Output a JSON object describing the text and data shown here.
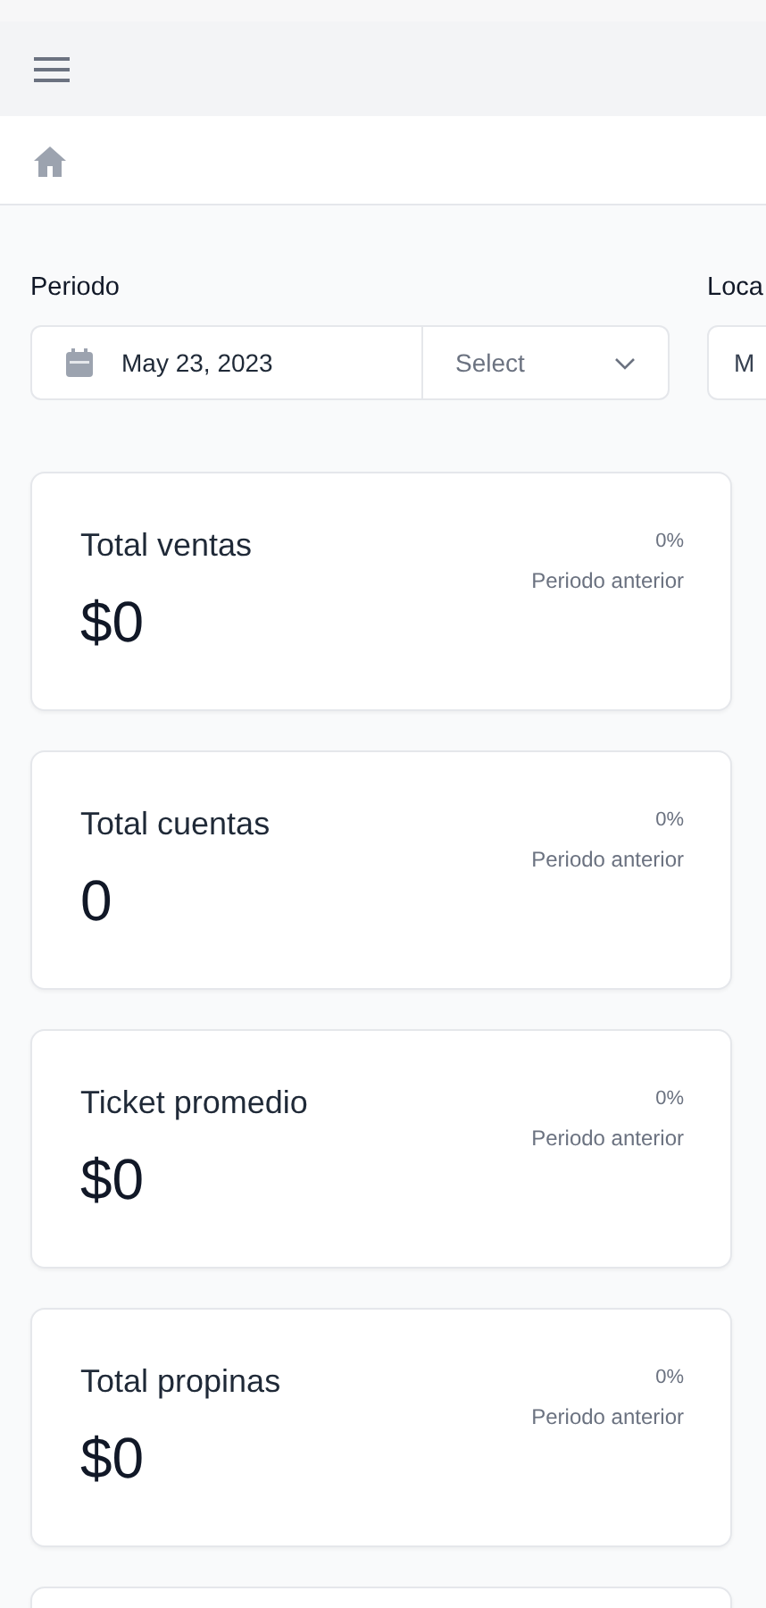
{
  "filters": [
    {
      "label": "Periodo",
      "date": "May 23, 2023",
      "select": "Select"
    },
    {
      "label": "Loca",
      "value": "M"
    }
  ],
  "cards": [
    {
      "title": "Total ventas",
      "value": "$0",
      "change": "0%",
      "caption": "Periodo anterior"
    },
    {
      "title": "Total cuentas",
      "value": "0",
      "change": "0%",
      "caption": "Periodo anterior"
    },
    {
      "title": "Ticket promedio",
      "value": "$0",
      "change": "0%",
      "caption": "Periodo anterior"
    },
    {
      "title": "Total propinas",
      "value": "$0",
      "change": "0%",
      "caption": "Periodo anterior"
    }
  ]
}
